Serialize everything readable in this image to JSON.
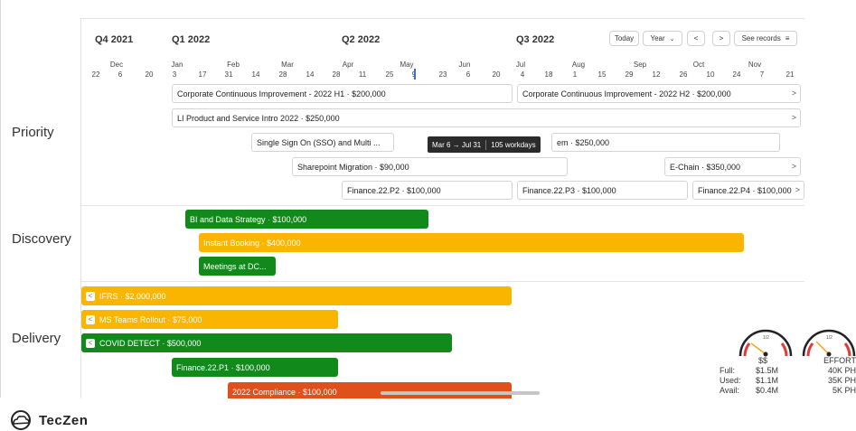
{
  "header": {
    "quarters": [
      "Q4 2021",
      "Q1 2022",
      "Q2 2022",
      "Q3 2022"
    ],
    "months": [
      "Dec",
      "Jan",
      "Feb",
      "Mar",
      "Apr",
      "May",
      "Jun",
      "Jul",
      "Aug",
      "Sep",
      "Oct",
      "Nov"
    ],
    "days": [
      "22",
      "6",
      "20",
      "3",
      "17",
      "31",
      "14",
      "28",
      "14",
      "28",
      "11",
      "25",
      "9",
      "23",
      "6",
      "20",
      "4",
      "18",
      "1",
      "15",
      "29",
      "12",
      "26",
      "10",
      "24",
      "7",
      "21"
    ],
    "today_button": "Today",
    "period_select": "Year",
    "prev_icon": "<",
    "next_icon": ">",
    "see_records": "See records",
    "menu_icon": "≡"
  },
  "lanes": {
    "priority": "Priority",
    "discovery": "Discovery",
    "delivery": "Delivery"
  },
  "bars": {
    "corp_h1": "Corporate Continuous Improvement - 2022 H1 · $200,000",
    "corp_h2": "Corporate Continuous Improvement - 2022 H2 · $200,000",
    "li_product": "LI Product and Service Intro 2022 · $250,000",
    "sso": "Single Sign On (SSO) and Multi ...",
    "sso_tail": "em · $250,000",
    "sharepoint": "Sharepoint Migration · $90,000",
    "echain": "E-Chain · $350,000",
    "fin_p2": "Finance.22.P2 · $100,000",
    "fin_p3": "Finance.22.P3 · $100,000",
    "fin_p4": "Finance.22.P4 · $100,000",
    "bi_data": "BI and Data Strategy · $100,000",
    "instant_booking": "Instant Booking · $400,000",
    "meetings": "Meetings at DC...",
    "ifrs": "IFRS · $2,000,000",
    "ms_teams": "MS Teams Rollout · $75,000",
    "covid": "COVID DETECT · $500,000",
    "fin_p1": "Finance.22.P1 · $100,000",
    "orange_partial": "2022 Compliance · $100,000"
  },
  "tooltip": {
    "range": "Mar 6 → Jul 31",
    "workdays": "105 workdays"
  },
  "metrics": {
    "col_money": "$$",
    "col_effort": "EFFORT",
    "rows": [
      {
        "label": "Full:",
        "money": "$1.5M",
        "effort": "40K PH"
      },
      {
        "label": "Used:",
        "money": "$1.1M",
        "effort": "35K PH"
      },
      {
        "label": "Avail:",
        "money": "$0.4M",
        "effort": "5K PH"
      }
    ],
    "gauge_scale": "1/2"
  },
  "logo": {
    "text": "TecZen"
  },
  "colors": {
    "green": "#118a1b",
    "yellow": "#f9b500",
    "orange": "#e0501a",
    "today_marker": "#3a6fd8"
  }
}
